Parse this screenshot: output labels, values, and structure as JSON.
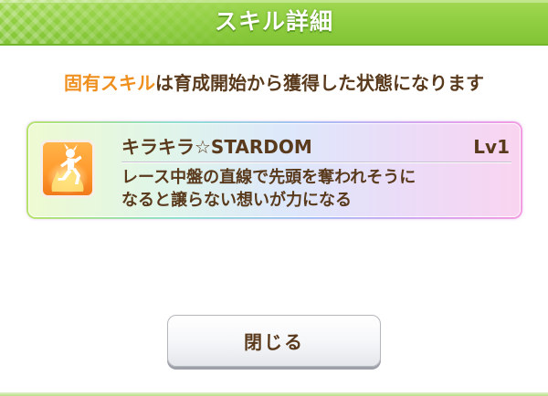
{
  "dialog": {
    "title": "スキル詳細"
  },
  "notice": {
    "highlight": "固有スキル",
    "text": "は育成開始から獲得した状態になります"
  },
  "skill": {
    "icon": "unique-skill-icon",
    "name": "キラキラ☆STARDOM",
    "level": "Lv1",
    "description": [
      "レース中盤の直線で先頭を奪われそうに",
      "なると譲らない想いが力になる"
    ]
  },
  "buttons": {
    "close_label": "閉じる"
  },
  "colors": {
    "header": "#8ecd3f",
    "highlight": "#ef8f1e",
    "text": "#5a3a1c",
    "card_left": "#eefad2",
    "card_mid": "#dde8fb",
    "card_right": "#f9d4f0"
  }
}
